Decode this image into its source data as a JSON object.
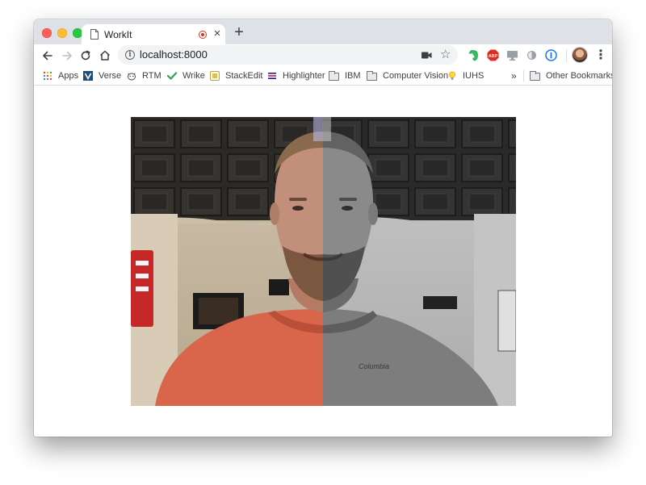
{
  "tab": {
    "title": "WorkIt",
    "recording_indicator": "recording-dot-icon",
    "close_icon": "close-icon"
  },
  "newtab_icon": "plus-icon",
  "toolbar": {
    "url": "localhost:8000",
    "icons": [
      "back-icon",
      "forward-icon",
      "reload-icon",
      "home-icon",
      "info-icon",
      "camera-icon",
      "star-icon"
    ]
  },
  "extensions": [
    "evernote-icon",
    "adblock-icon",
    "cast-icon",
    "dark-reader-icon",
    "1password-icon",
    "profile-avatar",
    "menu-icon"
  ],
  "bookmarks": {
    "items": [
      {
        "label": "Apps",
        "icon": "apps-grid-icon"
      },
      {
        "label": "Verse",
        "icon": "verse-icon"
      },
      {
        "label": "RTM",
        "icon": "rtm-cow-icon"
      },
      {
        "label": "Wrike",
        "icon": "wrike-check-icon"
      },
      {
        "label": "StackEdit",
        "icon": "stackedit-icon"
      },
      {
        "label": "Highlighter",
        "icon": "highlighter-icon"
      },
      {
        "label": "IBM",
        "icon": "folder-icon"
      },
      {
        "label": "Computer Vision",
        "icon": "folder-icon"
      },
      {
        "label": "IUHS",
        "icon": "lightbulb-icon"
      }
    ],
    "overflow": "»",
    "other": {
      "label": "Other Bookmarks",
      "icon": "folder-icon"
    }
  },
  "video": {
    "description_icon": "webcam-feed",
    "left_half": "color",
    "right_half": "grayscale"
  },
  "colors": {
    "tabstrip": "#dee1e6",
    "accent_record": "#d93025",
    "shirt": "#d9654a"
  }
}
